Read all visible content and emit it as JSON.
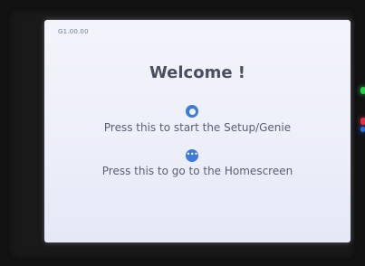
{
  "screen": {
    "version": "G1.00.00",
    "title": "Welcome !",
    "setup_button": {
      "icon": "radio-circle-icon",
      "label": "Press this to start the Setup/Genie"
    },
    "home_button": {
      "icon": "more-dots-icon",
      "glyph": "•••",
      "label": "Press this to go to the Homescreen"
    }
  },
  "colors": {
    "accent": "#3d7bd6",
    "text": "#5a6074",
    "title": "#4b4e62",
    "screen_background": "#eceef9",
    "bezel": "#191919"
  }
}
